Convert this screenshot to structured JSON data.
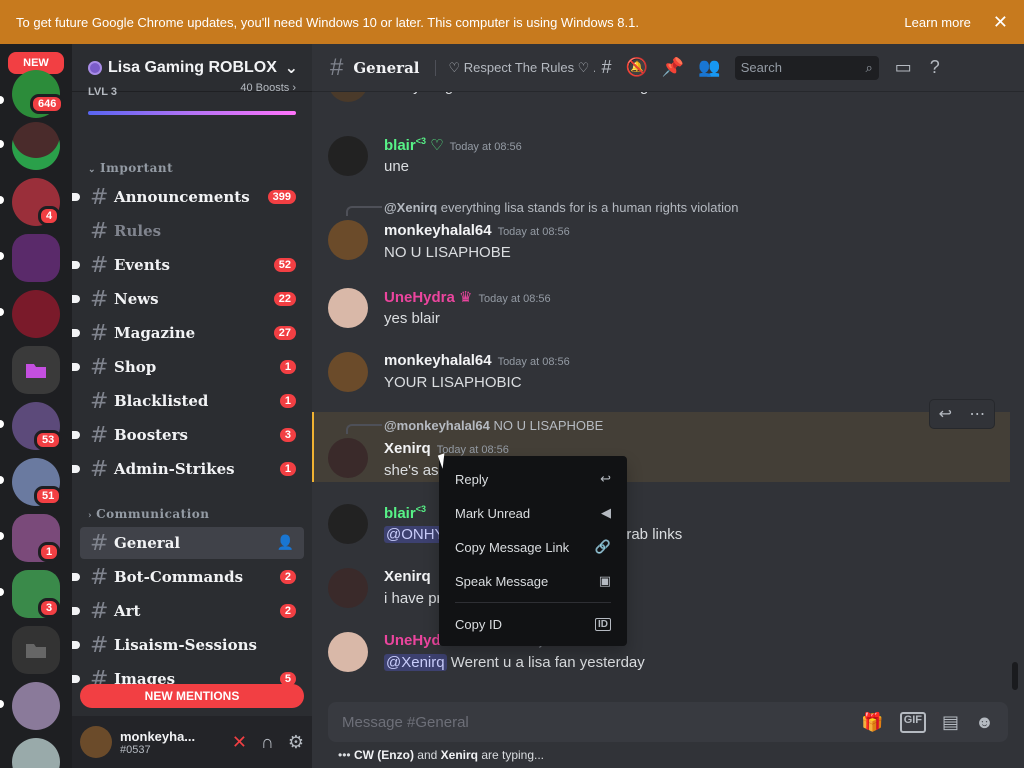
{
  "banner": {
    "text": "To get future Google Chrome updates, you'll need Windows 10 or later. This computer is using Windows 8.1.",
    "learn_more": "Learn more",
    "close": "✕"
  },
  "servers": {
    "new_label": "NEW",
    "badges": [
      "646",
      "4",
      "53",
      "51",
      "1",
      "3"
    ],
    "colors": [
      "#2c8c3a",
      "#4a2b2b",
      "#9a2f3a",
      "#5a2a6a",
      "#7a1a2a",
      "#3a3a3a",
      "#5c4a7a",
      "#7a4a7a",
      "#2a6a5a",
      "#3a8a4a",
      "#555",
      "#6a7aa0",
      "#7a7a9a"
    ]
  },
  "guild": {
    "name": "Lisa Gaming ROBLOX",
    "level": "LVL 3",
    "boosts": "40 Boosts ›",
    "accent_bar": "#5865f2"
  },
  "categories": [
    {
      "name": "Important"
    },
    {
      "name": "Communication"
    }
  ],
  "channels": [
    {
      "name": "Announcements",
      "badge": "399"
    },
    {
      "name": "Rules",
      "badge": ""
    },
    {
      "name": "Events",
      "badge": "52"
    },
    {
      "name": "News",
      "badge": "22"
    },
    {
      "name": "Magazine",
      "badge": "27"
    },
    {
      "name": "Shop",
      "badge": "1"
    },
    {
      "name": "Blacklisted",
      "badge": "1"
    },
    {
      "name": "Boosters",
      "badge": "3"
    },
    {
      "name": "Admin-Strikes",
      "badge": "1"
    },
    {
      "name": "General",
      "badge": ""
    },
    {
      "name": "Bot-Commands",
      "badge": "2"
    },
    {
      "name": "Art",
      "badge": "2"
    },
    {
      "name": "Lisaism-Sessions",
      "badge": ""
    },
    {
      "name": "Images",
      "badge": "5"
    }
  ],
  "new_mentions": "NEW MENTIONS",
  "user": {
    "name": "monkeyha...",
    "tag": "#0537"
  },
  "header": {
    "channel": "General",
    "topic": "♡ Respect The Rules ♡ ...",
    "search_placeholder": "Search"
  },
  "messages": [
    {
      "content": "everything lisa stands for is a human rights violation"
    },
    {
      "author": "blair",
      "author_sup": "<3",
      "ts": "Today at 08:56",
      "content": "une"
    },
    {
      "reply_author": "@Xenirq",
      "reply_text": "everything lisa stands for is a human rights violation",
      "author": "monkeyhalal64",
      "ts": "Today at 08:56",
      "content": "NO U LISAPHOBE"
    },
    {
      "author": "UneHydra",
      "ts": "Today at 08:56",
      "content": "yes blair"
    },
    {
      "author": "monkeyhalal64",
      "ts": "Today at 08:56",
      "content": "YOUR LISAPHOBIC"
    },
    {
      "reply_author": "@monkeyhalal64",
      "reply_text": "NO U LISAPHOBE",
      "author": "Xenirq",
      "ts": "Today at 08:56",
      "content": "she's as"
    },
    {
      "author": "blair",
      "author_sup": "<3",
      "mention": "@ONHY",
      "content": "grab links"
    },
    {
      "author": "Xenirq",
      "content": "i have pr"
    },
    {
      "author": "UneHydra",
      "ts": "Today at 08:56",
      "mention": "@Xenirq",
      "content": "Werent u a lisa fan yesterday"
    }
  ],
  "context_menu": [
    {
      "label": "Reply",
      "icon": "↩"
    },
    {
      "label": "Mark Unread",
      "icon": "◀"
    },
    {
      "label": "Copy Message Link",
      "icon": "🔗"
    },
    {
      "label": "Speak Message",
      "icon": "▣"
    },
    {
      "label": "Copy ID",
      "icon": "ID"
    }
  ],
  "composer": {
    "placeholder": "Message #General",
    "gif": "GIF"
  },
  "typing": {
    "user1": "CW (Enzo)",
    "and": " and ",
    "user2": "Xenirq",
    "suffix": " are typing..."
  }
}
